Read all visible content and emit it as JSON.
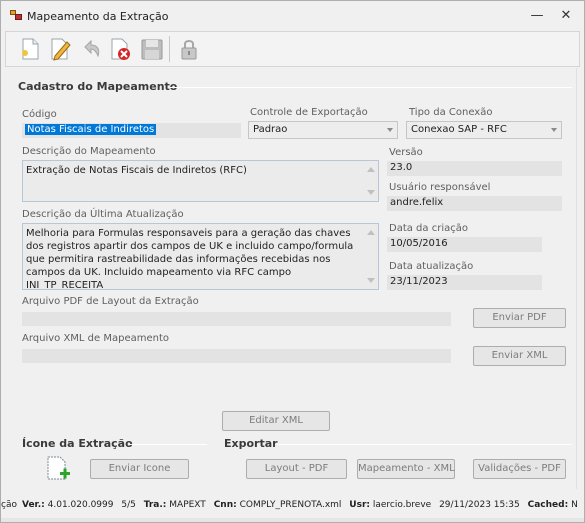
{
  "window": {
    "title": "Mapeamento da Extração",
    "minimize": "—",
    "close": "✕"
  },
  "toolbar": {
    "items": [
      {
        "name": "new-icon"
      },
      {
        "name": "edit-icon"
      },
      {
        "name": "undo-icon"
      },
      {
        "name": "delete-icon"
      },
      {
        "name": "save-icon"
      },
      {
        "name": "lock-icon"
      }
    ]
  },
  "form": {
    "section_title": "Cadastro do Mapeamento",
    "codigo": {
      "label": "Código",
      "value": "Notas Fiscais de Indiretos"
    },
    "controle_exportacao": {
      "label": "Controle de Exportação",
      "value": "Padrao"
    },
    "tipo_conexao": {
      "label": "Tipo da Conexão",
      "value": "Conexao SAP - RFC"
    },
    "descricao": {
      "label": "Descrição do Mapeamento",
      "value": "Extração de Notas Fiscais de Indiretos (RFC)"
    },
    "versao": {
      "label": "Versão",
      "value": "23.0"
    },
    "usuario": {
      "label": "Usuário responsável",
      "value": "andre.felix"
    },
    "ultima_atualizacao": {
      "label": "Descrição da Última Atualização",
      "value": "Melhoria para Formulas responsaveis para a geração das chaves dos registros apartir dos campos de UK e incluido campo/formula que permitira rastreabilidade das informações recebidas nos campos da UK. Incluido mapeamento via RFC campo INI_TP_RECEITA"
    },
    "data_criacao": {
      "label": "Data da criação",
      "value": "10/05/2016"
    },
    "data_atualizacao": {
      "label": "Data atualização",
      "value": "23/11/2023"
    },
    "arquivo_pdf": {
      "label": "Arquivo PDF de Layout da Extração",
      "value": "",
      "button": "Enviar PDF"
    },
    "arquivo_xml": {
      "label": "Arquivo XML de Mapeamento",
      "value": "",
      "button": "Enviar XML"
    },
    "editar_xml_button": "Editar XML"
  },
  "icone": {
    "section_title": "Ícone da Extração",
    "button": "Enviar Icone",
    "icon_name": "add-document-icon"
  },
  "exportar": {
    "section_title": "Exportar",
    "buttons": [
      "Layout - PDF",
      "Mapeamento - XML",
      "Validações - PDF"
    ]
  },
  "status": {
    "prefix": "ção",
    "ver_label": "Ver.:",
    "ver_value": "4.01.020.0999",
    "fraction": "5/5",
    "tra_label": "Tra.:",
    "tra_value": "MAPEXT",
    "cnn_label": "Cnn:",
    "cnn_value": "COMPLY_PRENOTA.xml",
    "usr_label": "Usr:",
    "usr_value": "laercio.breve",
    "datetime": "29/11/2023  15:35",
    "cached_label": "Cached:",
    "cached_value": "N"
  }
}
